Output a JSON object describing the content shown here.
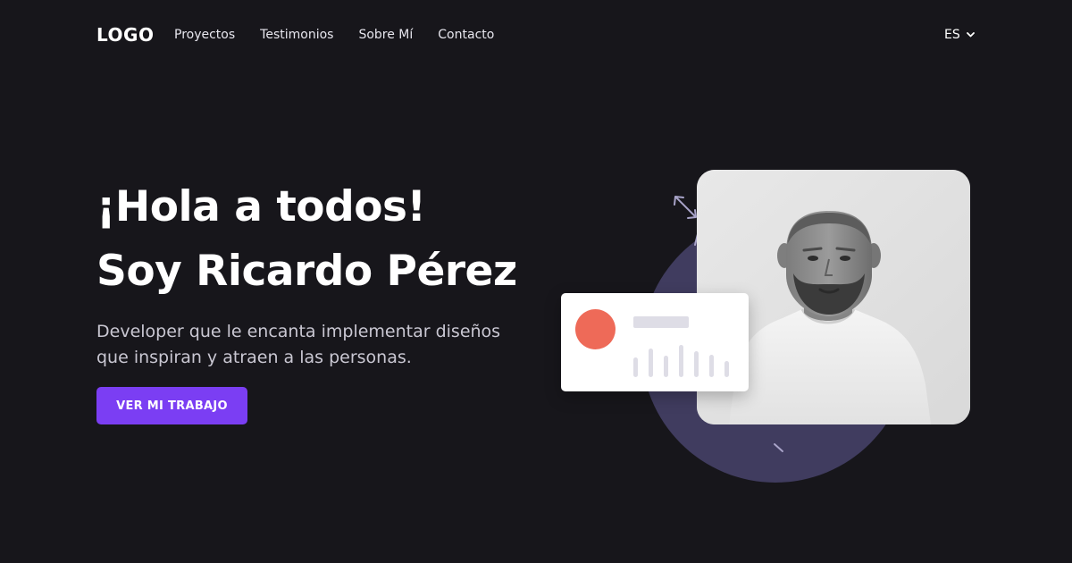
{
  "header": {
    "logo": "LOGO",
    "nav": [
      "Proyectos",
      "Testimonios",
      "Sobre Mí",
      "Contacto"
    ],
    "language": "ES"
  },
  "hero": {
    "title_line1": "¡Hola a todos!",
    "title_line2": "Soy Ricardo Pérez",
    "description_line1": "Developer que le encanta implementar diseños",
    "description_line2": "que inspiran y atraen a las personas.",
    "cta_label": "VER MI TRABAJO"
  },
  "illustration": {
    "card_bars": [
      0.55,
      0.8,
      0.6,
      0.9,
      0.72,
      0.62,
      0.45
    ],
    "colors": {
      "card_dot": "#ee6a58",
      "blob": "#403c5f",
      "accent": "#7b3ef3"
    }
  },
  "icons": {
    "language_chevron": "chevron-down-icon",
    "decorative_arrow": "arrow-diagonal-icon"
  }
}
